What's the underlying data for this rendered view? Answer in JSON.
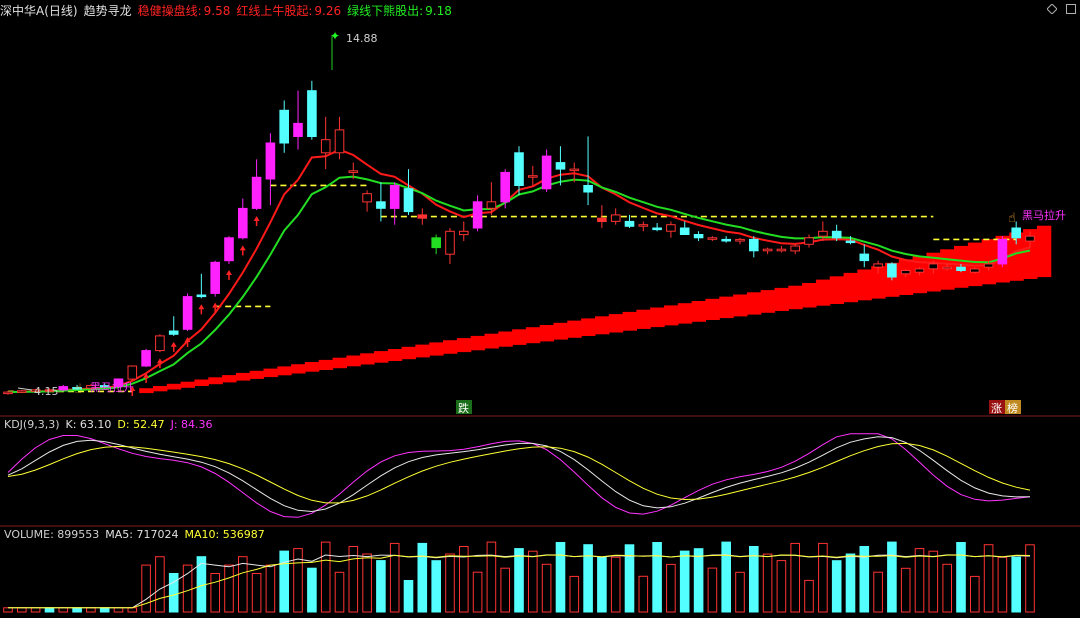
{
  "header": {
    "stock_name": "深中华A(日线)",
    "indicator_name": "趋势寻龙",
    "stable_label": "稳健操盘线:",
    "stable_value": "9.58",
    "red_label": "红线上牛股起:",
    "red_value": "9.26",
    "green_label": "绿线下熊股出:",
    "green_value": "9.18"
  },
  "main_chart": {
    "high_label": "14.88",
    "low_label": "4.15",
    "signal_buy": "黑马拉升",
    "marker_down": "跌",
    "marker_limit_up": "涨",
    "marker_list": "榜"
  },
  "kdj": {
    "title": "KDJ(9,3,3)",
    "k_label": "K: 63.10",
    "d_label": "D: 52.47",
    "j_label": "J: 84.36"
  },
  "volume": {
    "title": "VOLUME: 899553",
    "ma5_label": "MA5: 717024",
    "ma10_label": "MA10: 536987"
  },
  "icons": [
    "diamond-icon",
    "square-icon"
  ],
  "colors": {
    "up": "#ff3333",
    "down": "#54ffff",
    "magenta": "#ff22ff",
    "yellow": "#ffff33",
    "green": "#22dd22",
    "red_band": "#ff0000"
  },
  "chart_data": {
    "type": "candlestick",
    "yrange": [
      4,
      15.5
    ],
    "candles": [
      [
        4.15,
        4.22,
        4.1,
        4.18,
        "u"
      ],
      [
        4.2,
        4.25,
        4.15,
        4.22,
        "u"
      ],
      [
        4.22,
        4.28,
        4.18,
        4.25,
        "u"
      ],
      [
        4.25,
        4.3,
        4.2,
        4.23,
        "d"
      ],
      [
        4.25,
        4.4,
        4.22,
        4.35,
        "m"
      ],
      [
        4.3,
        4.4,
        4.25,
        4.32,
        "c"
      ],
      [
        4.3,
        4.42,
        4.25,
        4.38,
        "u"
      ],
      [
        4.38,
        4.45,
        4.3,
        4.35,
        "c"
      ],
      [
        4.35,
        4.6,
        4.3,
        4.58,
        "m"
      ],
      [
        4.58,
        5.0,
        4.55,
        4.98,
        "u"
      ],
      [
        4.98,
        5.5,
        4.95,
        5.45,
        "m"
      ],
      [
        5.45,
        5.95,
        5.4,
        5.9,
        "u"
      ],
      [
        5.95,
        6.5,
        5.9,
        6.05,
        "c"
      ],
      [
        6.1,
        7.2,
        6.05,
        7.1,
        "m"
      ],
      [
        7.1,
        7.8,
        7.05,
        7.15,
        "c"
      ],
      [
        7.2,
        8.2,
        7.1,
        8.15,
        "m"
      ],
      [
        8.2,
        8.95,
        8.1,
        8.9,
        "m"
      ],
      [
        8.9,
        10.1,
        8.85,
        9.8,
        "m"
      ],
      [
        9.8,
        11.3,
        9.75,
        10.75,
        "m"
      ],
      [
        10.7,
        12.1,
        9.9,
        11.8,
        "m"
      ],
      [
        11.8,
        13.1,
        11.5,
        12.8,
        "c"
      ],
      [
        12.4,
        13.4,
        11.6,
        12.0,
        "m"
      ],
      [
        12.0,
        13.7,
        11.9,
        13.4,
        "c"
      ],
      [
        11.9,
        12.6,
        11.0,
        11.5,
        "u"
      ],
      [
        11.5,
        12.6,
        11.3,
        12.2,
        "u"
      ],
      [
        10.9,
        11.2,
        10.7,
        10.95,
        "u"
      ],
      [
        10.0,
        10.35,
        9.7,
        10.25,
        "u"
      ],
      [
        9.8,
        10.6,
        9.4,
        10.0,
        "c"
      ],
      [
        9.8,
        10.6,
        9.3,
        10.5,
        "m"
      ],
      [
        10.4,
        11.0,
        9.6,
        9.7,
        "c"
      ],
      [
        9.6,
        9.8,
        9.3,
        9.5,
        "d"
      ],
      [
        8.6,
        9.0,
        8.4,
        8.9,
        "g"
      ],
      [
        8.4,
        9.2,
        8.1,
        9.1,
        "u"
      ],
      [
        9.1,
        9.4,
        8.8,
        9.0,
        "u"
      ],
      [
        9.2,
        10.2,
        9.1,
        10.0,
        "m"
      ],
      [
        10.0,
        10.6,
        9.6,
        9.8,
        "u"
      ],
      [
        10.0,
        11.0,
        9.8,
        10.9,
        "m"
      ],
      [
        10.5,
        11.7,
        10.2,
        11.5,
        "c"
      ],
      [
        10.8,
        11.1,
        10.5,
        10.8,
        "u"
      ],
      [
        10.4,
        11.6,
        10.3,
        11.4,
        "m"
      ],
      [
        11.0,
        11.7,
        10.5,
        11.2,
        "c"
      ],
      [
        11.0,
        11.2,
        10.6,
        11.0,
        "u"
      ],
      [
        10.3,
        12.0,
        9.9,
        10.5,
        "c"
      ],
      [
        9.5,
        9.9,
        9.2,
        9.4,
        "d"
      ],
      [
        9.4,
        9.8,
        9.3,
        9.6,
        "u"
      ],
      [
        9.4,
        9.6,
        9.2,
        9.25,
        "c"
      ],
      [
        9.3,
        9.4,
        9.1,
        9.3,
        "u"
      ],
      [
        9.2,
        9.35,
        9.1,
        9.15,
        "c"
      ],
      [
        9.1,
        9.4,
        8.9,
        9.3,
        "u"
      ],
      [
        9.2,
        9.4,
        9.1,
        9.0,
        "c"
      ],
      [
        9.0,
        9.1,
        8.8,
        8.9,
        "c"
      ],
      [
        8.9,
        8.95,
        8.8,
        8.88,
        "u"
      ],
      [
        8.85,
        8.95,
        8.75,
        8.8,
        "c"
      ],
      [
        8.8,
        8.9,
        8.7,
        8.85,
        "u"
      ],
      [
        8.85,
        8.95,
        8.3,
        8.5,
        "c"
      ],
      [
        8.5,
        8.6,
        8.4,
        8.55,
        "u"
      ],
      [
        8.55,
        8.65,
        8.45,
        8.5,
        "u"
      ],
      [
        8.5,
        8.7,
        8.4,
        8.65,
        "u"
      ],
      [
        8.7,
        9.0,
        8.6,
        8.9,
        "u"
      ],
      [
        8.95,
        9.4,
        8.8,
        9.1,
        "u"
      ],
      [
        9.1,
        9.3,
        8.8,
        8.9,
        "c"
      ],
      [
        8.8,
        8.95,
        8.7,
        8.8,
        "c"
      ],
      [
        8.4,
        8.7,
        8.0,
        8.2,
        "c"
      ],
      [
        8.0,
        8.2,
        7.8,
        8.1,
        "u"
      ],
      [
        8.1,
        8.15,
        7.6,
        7.7,
        "c"
      ],
      [
        7.8,
        7.95,
        7.7,
        7.9,
        "u"
      ],
      [
        7.85,
        8.0,
        7.75,
        7.95,
        "u"
      ],
      [
        7.95,
        8.2,
        7.8,
        8.1,
        "u"
      ],
      [
        8.0,
        8.1,
        7.9,
        8.0,
        "u"
      ],
      [
        7.9,
        8.1,
        7.85,
        8.0,
        "c"
      ],
      [
        7.85,
        8.0,
        7.8,
        7.95,
        "u"
      ],
      [
        8.0,
        8.2,
        7.9,
        8.1,
        "u"
      ],
      [
        8.1,
        8.95,
        8.0,
        8.85,
        "m"
      ],
      [
        8.9,
        9.4,
        8.7,
        9.2,
        "c"
      ],
      [
        8.8,
        9.1,
        8.6,
        8.95,
        "u"
      ]
    ]
  }
}
